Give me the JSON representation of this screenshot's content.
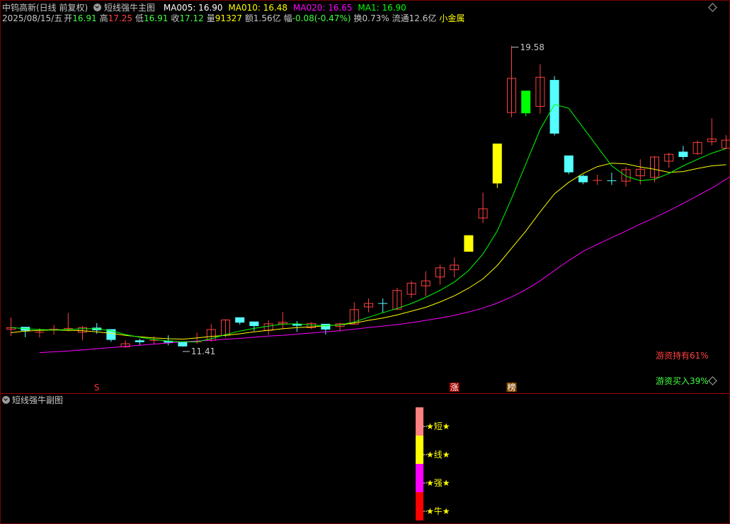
{
  "header": {
    "stock_name": "中钨高新(日线 前复权)",
    "indicator_name": "短线强牛主图",
    "ma5": "MA005: 16.90",
    "ma10": "MA010: 16.48",
    "ma20": "MA020: 16.65",
    "ma1": "MA1: 16.90"
  },
  "quote": {
    "date": "2025/08/15/五",
    "open_label": "开",
    "open": "16.91",
    "high_label": "高",
    "high": "17.25",
    "low_label": "低",
    "low": "16.91",
    "close_label": "收",
    "close": "17.12",
    "vol_label": "量",
    "vol": "91327",
    "amount": "额1.56亿",
    "change_label": "幅",
    "change": "-0.08(-0.47%)",
    "turnover": "换0.73%",
    "float_cap": "流通12.6亿",
    "sector": "小金属"
  },
  "sub_panel": {
    "title": "短线强牛副图"
  },
  "annotations": {
    "high_label": "19.58",
    "low_label": "11.41",
    "hot_money_hold": "游资持有61%",
    "hot_money_buy": "游资买入39%",
    "marker_s": "S",
    "marker_zhang": "涨",
    "marker_bang": "榜"
  },
  "legend_stack": [
    {
      "label": "★短★",
      "color": "#ff8080"
    },
    {
      "label": "★线★",
      "color": "#ffff00"
    },
    {
      "label": "★强★",
      "color": "#ff00ff"
    },
    {
      "label": "★牛★",
      "color": "#ff0000"
    }
  ],
  "colors": {
    "up": "#ff4040",
    "down": "#55ffff",
    "ma5": "#ffffff",
    "ma10": "#ffff00",
    "ma20": "#ff00ff",
    "ma1": "#00ff00",
    "green_text": "#40ff40",
    "red_text": "#ff4040",
    "strong_yellow": "#ffff00",
    "strong_green": "#00ff00"
  },
  "chart_data": {
    "type": "candlestick",
    "ylim": [
      11.0,
      20.0
    ],
    "candles": [
      {
        "o": 12.19,
        "h": 12.49,
        "l": 12.01,
        "c": 12.23
      },
      {
        "o": 12.24,
        "h": 12.24,
        "l": 11.98,
        "c": 12.16
      },
      {
        "o": 12.09,
        "h": 12.21,
        "l": 11.97,
        "c": 12.11
      },
      {
        "o": 12.19,
        "h": 12.3,
        "l": 12.05,
        "c": 12.19
      },
      {
        "o": 12.2,
        "h": 12.61,
        "l": 12.13,
        "c": 12.21
      },
      {
        "o": 12.11,
        "h": 12.27,
        "l": 11.9,
        "c": 12.23
      },
      {
        "o": 12.22,
        "h": 12.35,
        "l": 12.07,
        "c": 12.17
      },
      {
        "o": 12.18,
        "h": 12.18,
        "l": 11.86,
        "c": 11.92
      },
      {
        "o": 11.73,
        "h": 11.9,
        "l": 11.7,
        "c": 11.81
      },
      {
        "o": 11.89,
        "h": 11.94,
        "l": 11.78,
        "c": 11.86
      },
      {
        "o": 11.9,
        "h": 12.0,
        "l": 11.79,
        "c": 11.9
      },
      {
        "o": 11.88,
        "h": 12.03,
        "l": 11.77,
        "c": 11.85
      },
      {
        "o": 11.85,
        "h": 11.85,
        "l": 11.73,
        "c": 11.75
      },
      {
        "o": 11.84,
        "h": 12.1,
        "l": 11.81,
        "c": 11.86
      },
      {
        "o": 11.9,
        "h": 12.32,
        "l": 11.86,
        "c": 12.18
      },
      {
        "o": 12.03,
        "h": 12.45,
        "l": 11.98,
        "c": 12.43
      },
      {
        "o": 12.49,
        "h": 12.49,
        "l": 12.31,
        "c": 12.37
      },
      {
        "o": 12.38,
        "h": 12.38,
        "l": 12.14,
        "c": 12.28
      },
      {
        "o": 12.16,
        "h": 12.42,
        "l": 12.04,
        "c": 12.33
      },
      {
        "o": 12.33,
        "h": 12.64,
        "l": 12.2,
        "c": 12.37
      },
      {
        "o": 12.32,
        "h": 12.4,
        "l": 12.12,
        "c": 12.29
      },
      {
        "o": 12.23,
        "h": 12.37,
        "l": 12.19,
        "c": 12.34
      },
      {
        "o": 12.32,
        "h": 12.32,
        "l": 12.05,
        "c": 12.19
      },
      {
        "o": 12.26,
        "h": 12.36,
        "l": 12.13,
        "c": 12.33
      },
      {
        "o": 12.32,
        "h": 12.89,
        "l": 12.32,
        "c": 12.7
      },
      {
        "o": 12.77,
        "h": 12.99,
        "l": 12.63,
        "c": 12.86
      },
      {
        "o": 12.86,
        "h": 12.99,
        "l": 12.61,
        "c": 12.84
      },
      {
        "o": 12.71,
        "h": 13.27,
        "l": 12.69,
        "c": 13.2
      },
      {
        "o": 13.1,
        "h": 13.45,
        "l": 13.0,
        "c": 13.39
      },
      {
        "o": 13.32,
        "h": 13.7,
        "l": 13.05,
        "c": 13.45
      },
      {
        "o": 13.55,
        "h": 13.87,
        "l": 13.35,
        "c": 13.79
      },
      {
        "o": 13.74,
        "h": 14.06,
        "l": 13.54,
        "c": 13.86
      },
      {
        "o": 14.22,
        "h": 14.22,
        "l": 14.62,
        "c": 14.63,
        "strong": "yellow"
      },
      {
        "o": 15.09,
        "h": 15.75,
        "l": 14.96,
        "c": 15.33
      },
      {
        "o": 16.0,
        "h": 17.03,
        "l": 15.87,
        "c": 17.02,
        "strong": "yellow"
      },
      {
        "o": 17.84,
        "h": 19.58,
        "l": 17.72,
        "c": 18.73
      },
      {
        "o": 18.4,
        "h": 18.4,
        "l": 17.74,
        "c": 17.83,
        "strong": "green"
      },
      {
        "o": 18.0,
        "h": 19.1,
        "l": 17.81,
        "c": 18.76
      },
      {
        "o": 18.68,
        "h": 18.79,
        "l": 17.24,
        "c": 17.3
      },
      {
        "o": 16.71,
        "h": 16.71,
        "l": 16.23,
        "c": 16.29
      },
      {
        "o": 16.18,
        "h": 16.22,
        "l": 15.97,
        "c": 16.03
      },
      {
        "o": 16.07,
        "h": 16.22,
        "l": 15.95,
        "c": 16.07
      },
      {
        "o": 16.06,
        "h": 16.27,
        "l": 15.95,
        "c": 16.05
      },
      {
        "o": 16.05,
        "h": 16.42,
        "l": 15.91,
        "c": 16.35
      },
      {
        "o": 16.19,
        "h": 16.62,
        "l": 15.96,
        "c": 16.36
      },
      {
        "o": 16.15,
        "h": 16.7,
        "l": 16.02,
        "c": 16.68
      },
      {
        "o": 16.57,
        "h": 16.79,
        "l": 16.4,
        "c": 16.75
      },
      {
        "o": 16.81,
        "h": 16.97,
        "l": 16.61,
        "c": 16.69
      },
      {
        "o": 16.77,
        "h": 17.11,
        "l": 16.74,
        "c": 17.06
      },
      {
        "o": 17.08,
        "h": 17.69,
        "l": 16.98,
        "c": 17.15
      },
      {
        "o": 16.91,
        "h": 17.25,
        "l": 16.91,
        "c": 17.12
      }
    ],
    "ma5_last": 16.9,
    "ma10_last": 16.48,
    "ma20_last": 16.65,
    "ma1_last": 16.9,
    "ma10": [
      12.1,
      12.14,
      12.16,
      12.17,
      12.16,
      12.15,
      12.12,
      12.08,
      12.03,
      11.99,
      11.96,
      11.94,
      11.93,
      11.96,
      12.0,
      12.03,
      12.07,
      12.12,
      12.16,
      12.2,
      12.23,
      12.25,
      12.28,
      12.3,
      12.35,
      12.42,
      12.48,
      12.56,
      12.66,
      12.76,
      12.9,
      13.06,
      13.26,
      13.5,
      13.85,
      14.3,
      14.75,
      15.25,
      15.72,
      16.02,
      16.25,
      16.43,
      16.52,
      16.5,
      16.42,
      16.36,
      16.28,
      16.3,
      16.38,
      16.45,
      16.48
    ],
    "ma20": [
      11.58,
      11.6,
      11.62,
      11.65,
      11.68,
      11.71,
      11.74,
      11.77,
      11.8,
      11.83,
      11.86,
      11.88,
      11.9,
      11.93,
      11.95,
      11.98,
      12.01,
      12.03,
      12.06,
      12.09,
      12.12,
      12.15,
      12.19,
      12.23,
      12.27,
      12.31,
      12.36,
      12.42,
      12.48,
      12.55,
      12.64,
      12.74,
      12.87,
      13.03,
      13.22,
      13.45,
      13.72,
      13.98,
      14.22,
      14.4,
      14.58,
      14.75,
      14.93,
      15.1,
      15.28,
      15.47,
      15.67,
      15.87,
      16.1,
      16.35,
      16.65
    ],
    "ma1": [
      12.23,
      12.2,
      12.18,
      12.17,
      12.18,
      12.2,
      12.2,
      12.15,
      12.05,
      11.98,
      11.92,
      11.88,
      11.86,
      11.86,
      11.94,
      12.05,
      12.14,
      12.21,
      12.27,
      12.32,
      12.33,
      12.3,
      12.28,
      12.3,
      12.38,
      12.5,
      12.62,
      12.73,
      12.86,
      13.02,
      13.2,
      13.42,
      13.72,
      14.15,
      14.75,
      15.6,
      16.5,
      17.4,
      18.05,
      17.95,
      17.45,
      16.95,
      16.45,
      16.18,
      16.06,
      16.1,
      16.25,
      16.45,
      16.62,
      16.78,
      16.9
    ]
  }
}
